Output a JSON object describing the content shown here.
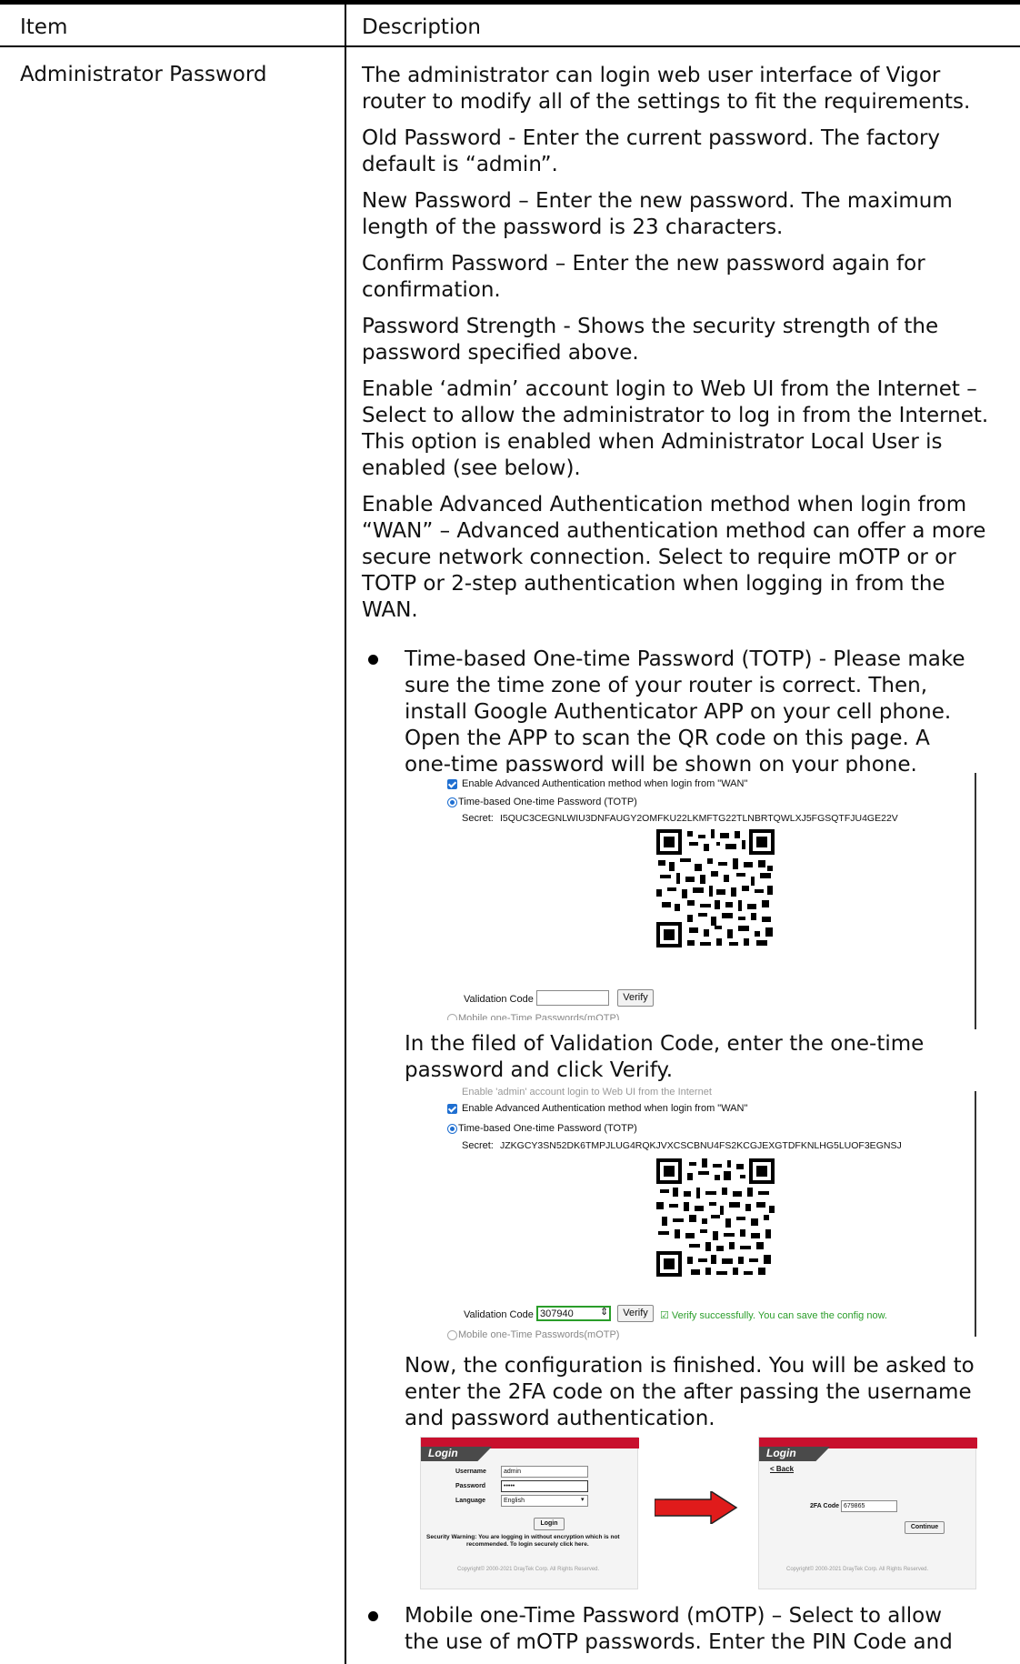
{
  "table": {
    "col_item": "Item",
    "col_description": "Description",
    "item": "Administrator Password"
  },
  "desc": {
    "p1": [
      "The administrator can login web user interface of Vigor",
      "router to modify all of the settings to fit the requirements."
    ],
    "p2": [
      "Old Password - Enter the current password. The factory",
      "default is “admin”."
    ],
    "p3": [
      "New Password – Enter the new password. The maximum",
      "length of the password is 23 characters."
    ],
    "p4": [
      "Confirm Password – Enter the new password again for",
      "confirmation."
    ],
    "p5": [
      "Password Strength - Shows the security strength of the",
      "password specified above."
    ],
    "p6": [
      "Enable ‘admin’ account login to Web UI from the Internet –",
      "Select to allow the administrator to log in from the Internet.",
      "This option is enabled when Administrator Local User is",
      "enabled (see below)."
    ],
    "p7": [
      "Enable Advanced Authentication method when login from",
      "“WAN” – Advanced authentication method can offer a more",
      "secure network connection. Select to require mOTP or or",
      "TOTP or 2-step authentication when logging in from the",
      "WAN."
    ],
    "b1": [
      "Time-based One-time Password (TOTP) - Please make",
      "sure the time zone of your router is correct. Then,",
      "install Google Authenticator APP on your cell phone.",
      "Open the APP to scan the QR code on this page. A",
      "one-time password will be shown on your phone."
    ],
    "after1": [
      "In the filed of Validation Code, enter the one-time",
      "password and click Verify."
    ],
    "after2": [
      "Now, the configuration is finished. You will be asked to",
      "enter the 2FA code on the after passing the username",
      "and password authentication."
    ],
    "b2": [
      "Mobile one-Time Password (mOTP) – Select to allow",
      "the use of mOTP passwords. Enter the PIN Code and"
    ]
  },
  "shot1": {
    "enable_adv": "Enable Advanced Authentication method when login from \"WAN\"",
    "totp_radio": "Time-based One-time Password (TOTP)",
    "secret_label": "Secret:",
    "secret": "I5QUC3CEGNLWIU3DNFAUGY2OMFKU22LKMFTG22TLNBRTQWLXJ5FGSQTFJU4GE22V",
    "validation_label": "Validation Code",
    "validation_value": "",
    "verify": "Verify",
    "motp_radio": "Mobile one-Time Passwords(mOTP)"
  },
  "shot2": {
    "enable_admin": "Enable 'admin' account login to Web UI from the Internet",
    "enable_adv": "Enable Advanced Authentication method when login from \"WAN\"",
    "totp_radio": "Time-based One-time Password (TOTP)",
    "secret_label": "Secret:",
    "secret": "JZKGCY3SN52DK6TMPJLUG4RQKJVXCSCBNU4FS2KCGJEXGTDFKNLHG5LUOF3EGNSJ",
    "validation_label": "Validation Code",
    "validation_value": "307940",
    "verify": "Verify",
    "success": "☑ Verify successfully. You can save the config now.",
    "motp_radio": "Mobile one-Time Passwords(mOTP)"
  },
  "shot3": {
    "login_title": "Login",
    "username_label": "Username",
    "username_value": "admin",
    "password_label": "Password",
    "password_value": "•••••",
    "language_label": "Language",
    "language_value": "English",
    "login_button": "Login",
    "warning": [
      "Security Warning: You are logging in without encryption which is not",
      "recommended. To login securely click here."
    ],
    "copyright": "Copyright© 2000-2021 DrayTek Corp. All Rights Reserved.",
    "login2_title": "Login",
    "back_link": "< Back",
    "twofa_label": "2FA Code",
    "twofa_value": "679865",
    "continue_button": "Continue",
    "copyright2": "Copyright© 2000-2021 DrayTek Corp. All Rights Reserved."
  }
}
